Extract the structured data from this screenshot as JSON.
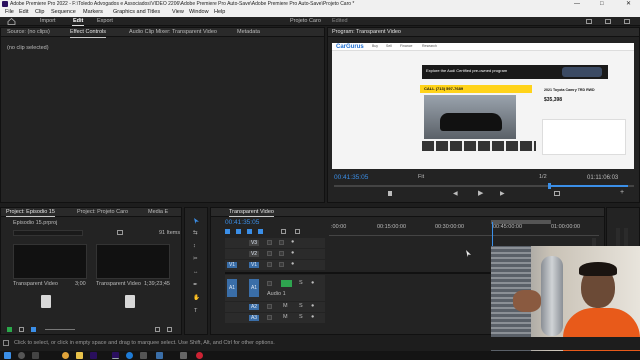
{
  "titlebar": {
    "title": "Adobe Premiere Pro 2022 - F:\\Toledo Advogados e Associados\\VIDEO 2206\\Adobe Premiere Pro Auto-Save\\Adobe Premiere Pro Auto-Save\\Projeto Caro *"
  },
  "menu": [
    "File",
    "Edit",
    "Clip",
    "Sequence",
    "Markers",
    "Graphics and Titles",
    "View",
    "Window",
    "Help"
  ],
  "workspace": {
    "tabs": [
      "Import",
      "Edit",
      "Export"
    ],
    "active": "Edit",
    "project": "Projeto Caro",
    "status": "Edited"
  },
  "source_panel": {
    "tabs": [
      "Source: (no clips)",
      "Effect Controls",
      "Audio Clip Mixer: Transparent Video",
      "Metadata"
    ],
    "no_clip": "(no clip selected)"
  },
  "program_panel": {
    "title": "Program: Transparent Video",
    "timecode": "00:41:35:05",
    "fit": "Fit",
    "resolution": "1/2",
    "duration": "01:11:06:03",
    "page": {
      "logo": "CarGurus",
      "nav": [
        "Buy",
        "Sell",
        "Finance",
        "Research"
      ],
      "banner": "Explore the Audi Certified pre-owned program",
      "call": "CALL (713) 597-7689",
      "car_title": "2021 Toyota Camry TRD RWD",
      "price": "$35,398"
    }
  },
  "project_panel": {
    "tabs": [
      "Project: Episodio 15",
      "Project: Projeto Caro",
      "Media E"
    ],
    "file": "Episodio 15.prproj",
    "count": "91 Items",
    "items": [
      {
        "name": "Transparent Video",
        "duration": "3;00"
      },
      {
        "name": "Transparent Video",
        "duration": "1;39;23;45"
      },
      {
        "name": "",
        "duration": ""
      },
      {
        "name": "",
        "duration": ""
      }
    ]
  },
  "timeline": {
    "tab": "Transparent Video",
    "timecode": "00:41:35:05",
    "ruler": [
      ":00:00",
      "00:15:00:00",
      "00:30:00:00",
      "00:45:00:00",
      "01:00:00:00"
    ],
    "video_tracks": [
      "V3",
      "V2",
      "V1"
    ],
    "audio_tracks": [
      "A1",
      "A2",
      "A3"
    ],
    "audio_label": "Audio 1"
  },
  "status": {
    "hint": "Click to select, or click in empty space and drag to marquee select. Use Shift, Alt, and Ctrl for other options."
  },
  "colors": {
    "accent": "#3b8fe8",
    "panel": "#232323",
    "clip_blue": "#3a6ea8",
    "clip_pink": "#b97fc4"
  }
}
